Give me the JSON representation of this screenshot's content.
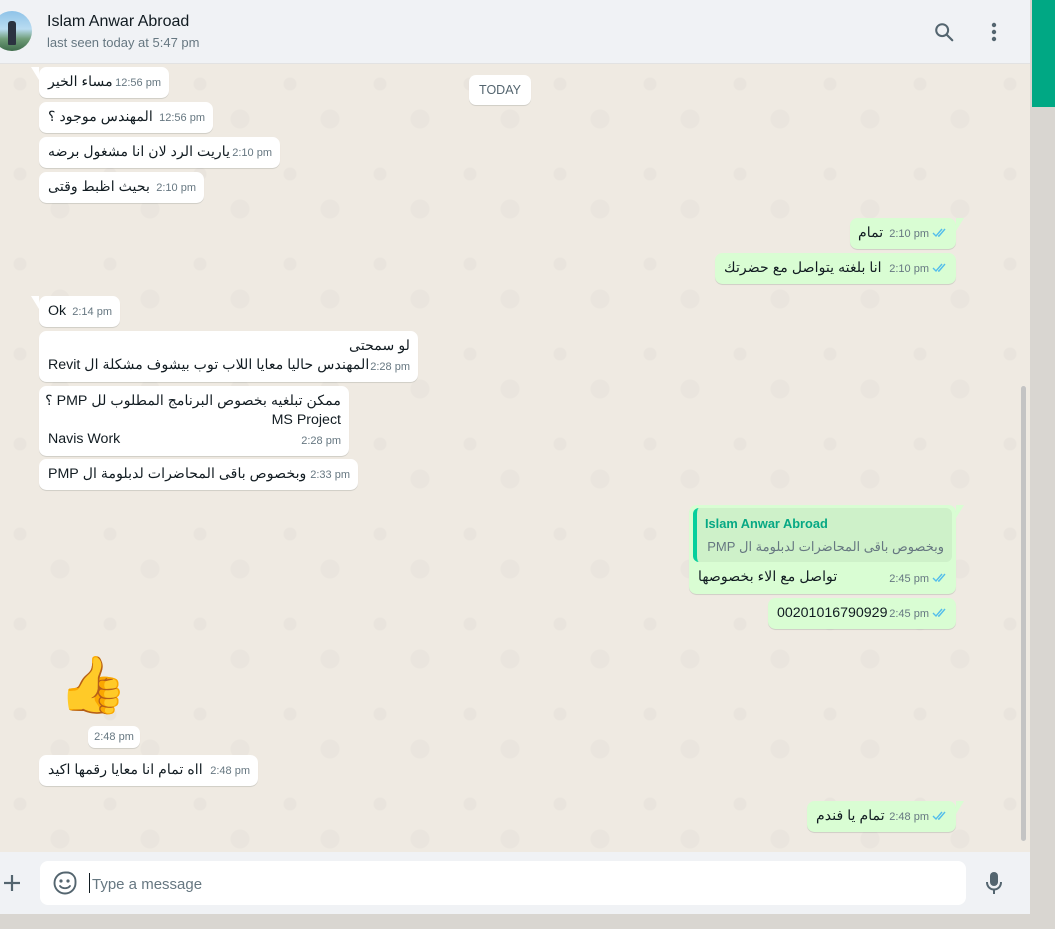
{
  "header": {
    "contact_name": "Islam Anwar Abroad",
    "last_seen": "last seen today at 5:47 pm"
  },
  "date_divider": "TODAY",
  "messages": [
    {
      "dir": "in",
      "text": "مساء الخير",
      "time": "12:56 pm"
    },
    {
      "dir": "in",
      "text": "المهندس موجود ؟",
      "time": "12:56 pm"
    },
    {
      "dir": "in",
      "text": "ياريت الرد لان انا مشغول برضه",
      "time": "2:10 pm"
    },
    {
      "dir": "in",
      "text": "بحيث اظبط وقتى",
      "time": "2:10 pm"
    },
    {
      "dir": "out",
      "text": "تمام",
      "time": "2:10 pm"
    },
    {
      "dir": "out",
      "text": "انا بلغته يتواصل مع حضرتك",
      "time": "2:10 pm"
    },
    {
      "dir": "in",
      "text": "Ok",
      "time": "2:14 pm"
    },
    {
      "dir": "in",
      "lines": [
        "لو سمحتى",
        "المهندس حاليا معايا اللاب توب بيشوف مشكلة ال Revit"
      ],
      "time": "2:28 pm"
    },
    {
      "dir": "in",
      "lines": [
        "ممكن تبلغيه بخصوص البرنامج المطلوب لل PMP ؟",
        "MS Project",
        "Navis Work"
      ],
      "time": "2:28 pm"
    },
    {
      "dir": "in",
      "text": "وبخصوص باقى المحاضرات لدبلومة ال PMP",
      "time": "2:33 pm"
    },
    {
      "dir": "out",
      "quote_author": "Islam Anwar Abroad",
      "quote_text": "وبخصوص باقى المحاضرات لدبلومة ال PMP",
      "text": "تواصل مع الاء بخصوصها",
      "time": "2:45 pm"
    },
    {
      "dir": "out",
      "text": "00201016790929",
      "time": "2:45 pm"
    },
    {
      "dir": "in",
      "sticker": "thumbs-up",
      "time": "2:48 pm"
    },
    {
      "dir": "in",
      "text": "ااه تمام انا معايا رقمها اكيد",
      "time": "2:48 pm"
    },
    {
      "dir": "out",
      "text": "تمام يا فندم",
      "time": "2:48 pm"
    }
  ],
  "composer": {
    "placeholder": "Type a message"
  },
  "colors": {
    "incoming_bubble": "#ffffff",
    "outgoing_bubble": "#d9fdd3",
    "read_ticks": "#53bdeb",
    "accent": "#00a884",
    "quote_author": "#06a884"
  },
  "icons": [
    "search-icon",
    "menu-icon",
    "attach-icon",
    "emoji-icon",
    "mic-icon",
    "double-check-icon",
    "thumbs-up-sticker"
  ]
}
